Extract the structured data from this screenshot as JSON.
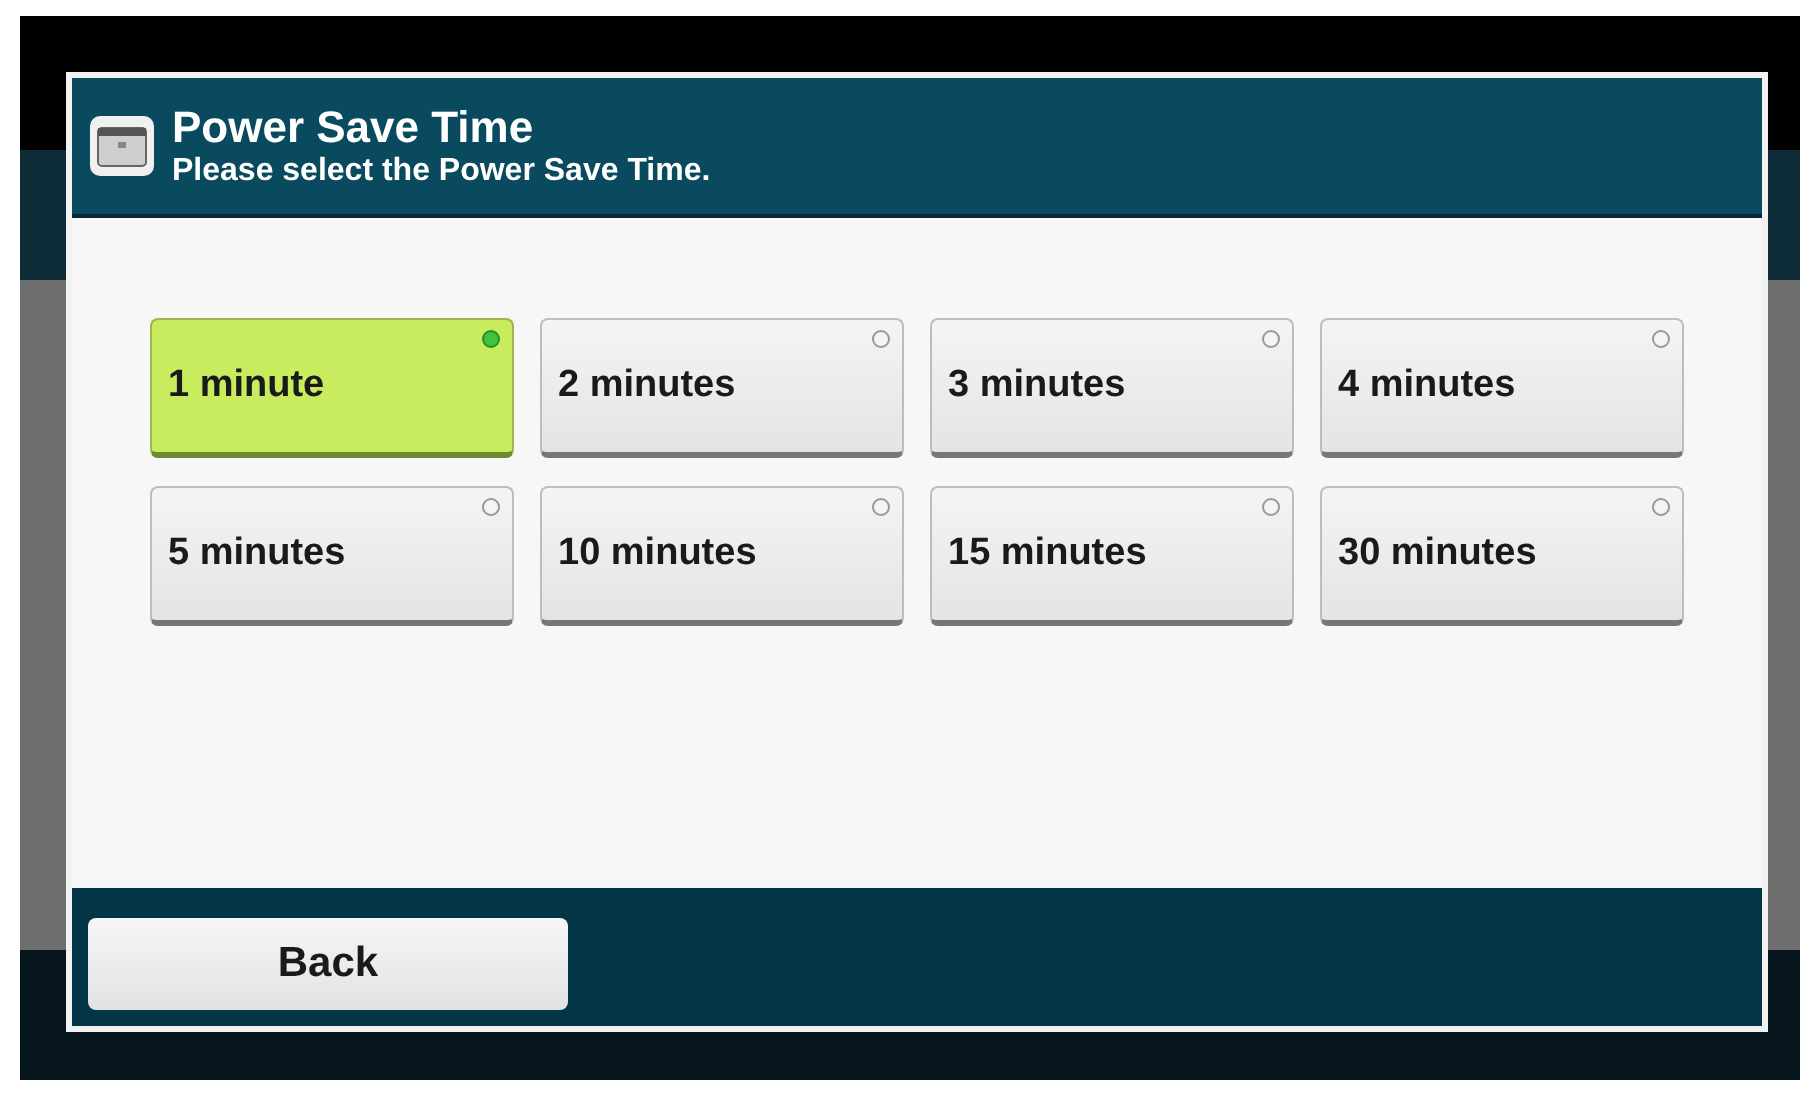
{
  "dialog": {
    "title": "Power Save Time",
    "subtitle": "Please select the Power Save Time."
  },
  "options": [
    {
      "label": "1 minute",
      "selected": true
    },
    {
      "label": "2 minutes",
      "selected": false
    },
    {
      "label": "3 minutes",
      "selected": false
    },
    {
      "label": "4 minutes",
      "selected": false
    },
    {
      "label": "5 minutes",
      "selected": false
    },
    {
      "label": "10 minutes",
      "selected": false
    },
    {
      "label": "15 minutes",
      "selected": false
    },
    {
      "label": "30 minutes",
      "selected": false
    }
  ],
  "footer": {
    "back_button": "Back"
  }
}
